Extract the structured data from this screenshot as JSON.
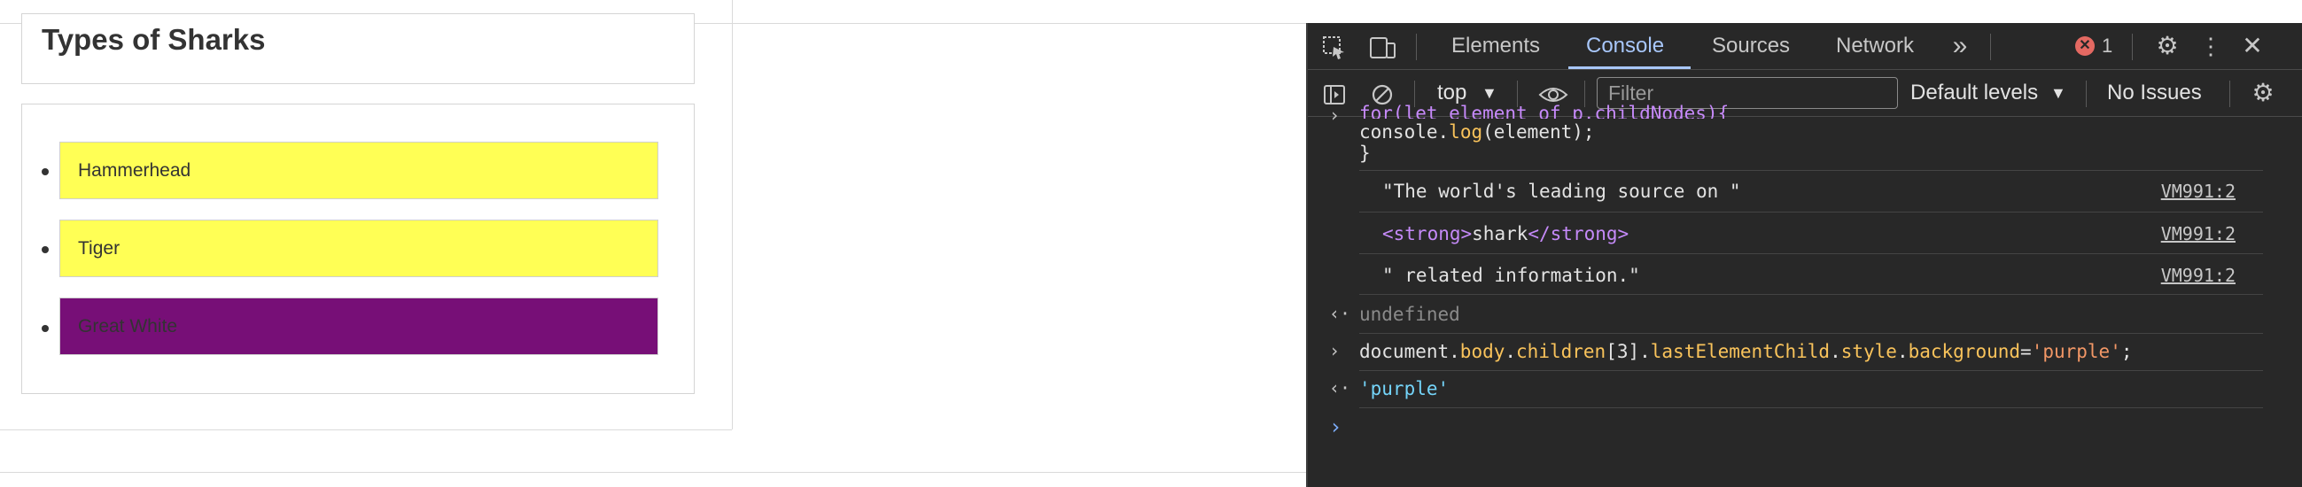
{
  "page": {
    "title": "Types of Sharks",
    "sharks": [
      {
        "name": "Hammerhead",
        "bg": "#ffff55"
      },
      {
        "name": "Tiger",
        "bg": "#ffff55"
      },
      {
        "name": "Great White",
        "bg": "#770f77"
      }
    ]
  },
  "devtools": {
    "tabs": [
      "Elements",
      "Console",
      "Sources",
      "Network"
    ],
    "active_tab": "Console",
    "more_tabs_icon": "chevron-double-right-icon",
    "error_count": "1",
    "toolbar": {
      "context": "top",
      "filter_placeholder": "Filter",
      "levels": "Default levels",
      "issues": "No Issues"
    },
    "console": {
      "code_partial": "for(let element of p.childNodes){",
      "code_line2_obj": "console",
      "code_line2_fn": "log",
      "code_line2_arg": "(element);",
      "code_line3": "}",
      "logs": [
        {
          "text": "\"The world's leading source on \"",
          "source": "VM991:2"
        },
        {
          "tag_open": "<strong>",
          "inner": "shark",
          "tag_close": "</strong>",
          "source": "VM991:2"
        },
        {
          "text": "\" related information.\"",
          "source": "VM991:2"
        }
      ],
      "result1": "undefined",
      "command": {
        "p1": "document.",
        "p2": "body",
        "p3": ".",
        "p4": "children",
        "p5": "[3].",
        "p6": "lastElementChild",
        "p7": ".",
        "p8": "style",
        "p9": ".",
        "p10": "background",
        "p11": "=",
        "p12": "'purple'",
        "p13": ";"
      },
      "result2": "'purple'"
    }
  }
}
